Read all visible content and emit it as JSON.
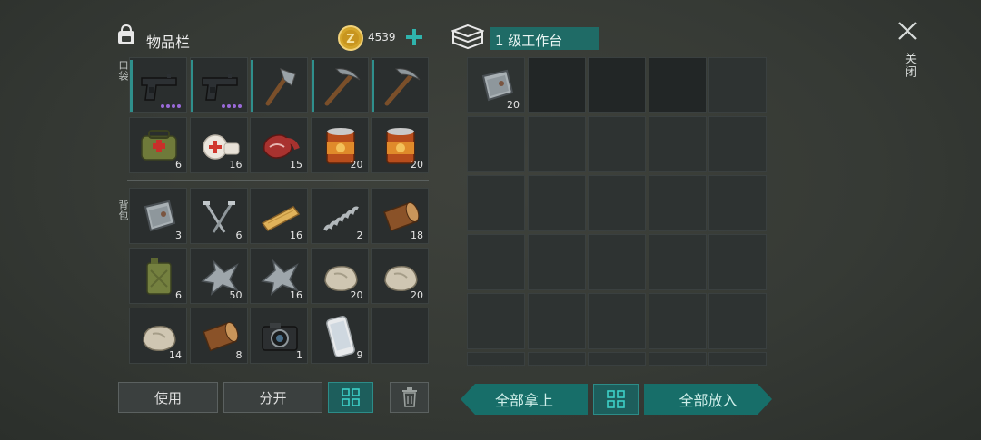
{
  "inventory": {
    "title": "物品栏",
    "coins": "4539",
    "pocket_label": "口袋",
    "backpack_label": "背包",
    "pocket": [
      {
        "icon": "pistol-icon",
        "qty": "",
        "dots": 4,
        "bar": true
      },
      {
        "icon": "pistol-icon",
        "qty": "",
        "dots": 4,
        "bar": true
      },
      {
        "icon": "hatchet-icon",
        "qty": "",
        "dots": 0,
        "bar": true
      },
      {
        "icon": "pickaxe-icon",
        "qty": "",
        "dots": 0,
        "bar": true
      },
      {
        "icon": "pickaxe-icon",
        "qty": "",
        "dots": 0,
        "bar": true
      },
      {
        "icon": "first-aid-bag-icon",
        "qty": "6",
        "dots": 0,
        "bar": false
      },
      {
        "icon": "bandage-icon",
        "qty": "16",
        "dots": 0,
        "bar": false
      },
      {
        "icon": "raw-meat-icon",
        "qty": "15",
        "dots": 0,
        "bar": false
      },
      {
        "icon": "canned-food-icon",
        "qty": "20",
        "dots": 0,
        "bar": false
      },
      {
        "icon": "canned-food-icon",
        "qty": "20",
        "dots": 0,
        "bar": false
      }
    ],
    "backpack": [
      {
        "icon": "metal-plate-icon",
        "qty": "3"
      },
      {
        "icon": "nails-icon",
        "qty": "6"
      },
      {
        "icon": "wood-plank-icon",
        "qty": "16"
      },
      {
        "icon": "spring-icon",
        "qty": "2"
      },
      {
        "icon": "log-icon",
        "qty": "18"
      },
      {
        "icon": "fuel-canister-icon",
        "qty": "6"
      },
      {
        "icon": "scrap-metal-icon",
        "qty": "50"
      },
      {
        "icon": "scrap-metal-icon",
        "qty": "16"
      },
      {
        "icon": "stone-icon",
        "qty": "20"
      },
      {
        "icon": "stone-icon",
        "qty": "20"
      },
      {
        "icon": "stone-icon",
        "qty": "14"
      },
      {
        "icon": "log-icon",
        "qty": "8"
      },
      {
        "icon": "camera-icon",
        "qty": "1"
      },
      {
        "icon": "smartphone-icon",
        "qty": "9"
      },
      {
        "icon": "",
        "qty": ""
      }
    ],
    "use_label": "使用",
    "split_label": "分开"
  },
  "workbench": {
    "title": "1 级工作台",
    "slots": [
      {
        "icon": "metal-plate-icon",
        "qty": "20"
      }
    ],
    "take_all_label": "全部拿上",
    "put_all_label": "全部放入"
  },
  "close_label": "关闭",
  "colors": {
    "accent": "#2f8f8c",
    "bench_title_bg": "#1f6b66",
    "coin": "#d4a52a",
    "rarity_dot": "#9a6ad8"
  }
}
